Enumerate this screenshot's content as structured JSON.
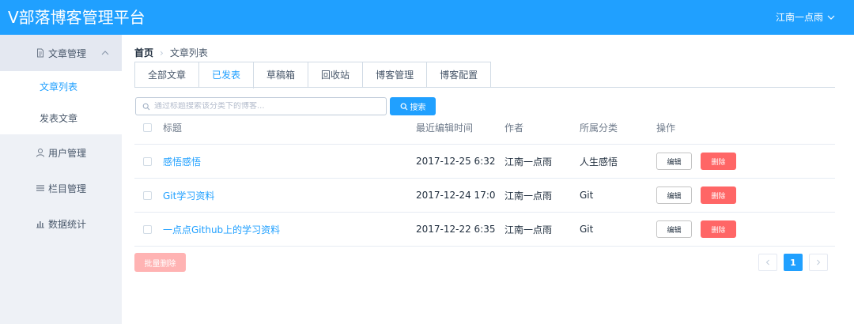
{
  "header": {
    "app_title": "V部落博客管理平台",
    "user_name": "江南一点雨"
  },
  "sidebar": {
    "article_menu": "文章管理",
    "article_sub": [
      "文章列表",
      "发表文章"
    ],
    "user_menu": "用户管理",
    "column_menu": "栏目管理",
    "stats_menu": "数据统计"
  },
  "breadcrumb": {
    "home": "首页",
    "current": "文章列表"
  },
  "tabs": [
    "全部文章",
    "已发表",
    "草稿箱",
    "回收站",
    "博客管理",
    "博客配置"
  ],
  "active_tab": "已发表",
  "search": {
    "placeholder": "通过标题搜索该分类下的博客...",
    "button": "搜索"
  },
  "table": {
    "headers": {
      "title": "标题",
      "date": "最近编辑时间",
      "author": "作者",
      "category": "所属分类",
      "ops": "操作"
    },
    "rows": [
      {
        "title": "感悟感悟",
        "date": "2017-12-25 6:32",
        "author": "江南一点雨",
        "category": "人生感悟"
      },
      {
        "title": "Git学习资料",
        "date": "2017-12-24 17:0",
        "author": "江南一点雨",
        "category": "Git"
      },
      {
        "title": "一点点Github上的学习资料",
        "date": "2017-12-22 6:35",
        "author": "江南一点雨",
        "category": "Git"
      }
    ],
    "edit_label": "编辑",
    "delete_label": "删除"
  },
  "batch_delete": "批量删除",
  "pagination": {
    "current_page": "1"
  },
  "colors": {
    "primary": "#20a0ff",
    "danger": "#ff6666",
    "sidebar_bg": "#eef1f6"
  }
}
